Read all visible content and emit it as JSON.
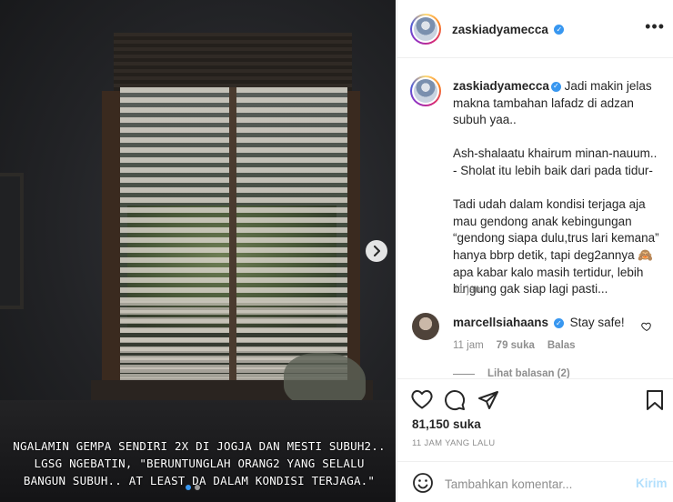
{
  "post": {
    "overlay_caption": "NGALAMIN GEMPA SENDIRI 2X DI JOGJA DAN MESTI SUBUH2.. LGSG NGEBATIN, \"BERUNTUNGLAH ORANG2 YANG SELALU BANGUN SUBUH.. AT LEAST DA DALAM KONDISI TERJAGA.\"",
    "carousel_pages": 2,
    "carousel_active": 1
  },
  "header": {
    "username": "zaskiadyamecca",
    "verified_icon": "verified-badge-icon",
    "more_icon": "more-options-icon"
  },
  "caption": {
    "username": "zaskiadyamecca",
    "text": "Jadi makin jelas makna tambahan lafadz di adzan subuh yaa..\n\nAsh-shalaatu khairum minan-nauum..\n- Sholat itu lebih baik dari pada tidur-\n\nTadi udah dalam kondisi terjaga aja mau gendong anak kebingungan “gendong siapa dulu,trus lari kemana” hanya bbrp detik, tapi deg2annya 🙈 apa kabar kalo masih tertidur, lebih bingung gak siap lagi pasti...",
    "time": "11 jam"
  },
  "comment": {
    "username": "marcellsiahaans",
    "text": "Stay safe!",
    "time": "11 jam",
    "likes": "79 suka",
    "reply": "Balas",
    "view_replies": "Lihat balasan (2)"
  },
  "actions": {
    "like_icon": "heart-icon",
    "comment_icon": "comment-icon",
    "share_icon": "share-icon",
    "save_icon": "bookmark-icon"
  },
  "likes_count": "81,150 suka",
  "timestamp": "11 JAM YANG LALU",
  "add_comment": {
    "placeholder": "Tambahkan komentar...",
    "post_label": "Kirim",
    "emoji_icon": "emoji-icon"
  },
  "colors": {
    "accent": "#3897f0",
    "post_disabled": "#b2dffc",
    "meta_text": "#8e8e8e"
  }
}
